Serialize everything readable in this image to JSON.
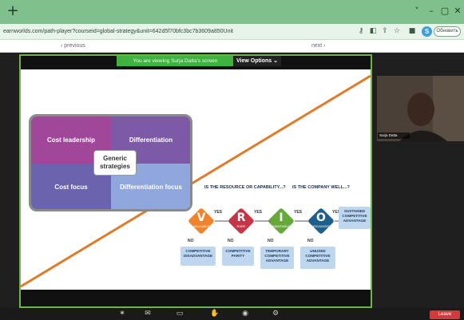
{
  "browser": {
    "new_tab": "+",
    "window_controls": [
      "˅",
      "–",
      "▢",
      "✕"
    ],
    "url": "earnworlds.com/path-player?courseid=global-strategy&unit=642d5f70bfc3bc7b3609a850Unit",
    "profile_letter": "S",
    "profile_button": "Обновить"
  },
  "page_nav": {
    "previous": "‹ previous",
    "next": "next ›"
  },
  "share": {
    "viewing_text": "You are viewing Surja Datta's screen",
    "view_options": "View Options ⌄"
  },
  "generic": {
    "center": "Generic strategies",
    "cells": [
      "Cost leadership",
      "Differentiation",
      "Cost focus",
      "Differentiation focus"
    ]
  },
  "vrio": {
    "question_left": "IS THE RESOURCE OR CAPABILITY...?",
    "question_right": "IS THE COMPANY WELL...?",
    "yes_label": "YES",
    "no_label": "NO",
    "diamonds": [
      {
        "letter": "V",
        "sub": "VALUABLE",
        "color": "#f0842c"
      },
      {
        "letter": "R",
        "sub": "RARE",
        "color": "#c63546"
      },
      {
        "letter": "I",
        "sub": "INIMITABLE",
        "color": "#67a83a"
      },
      {
        "letter": "O",
        "sub": "ORGANIZED",
        "color": "#1f5f8b"
      }
    ],
    "outcomes": [
      "COMPETITIVE DISADVANTAGE",
      "COMPETITIVE PARITY",
      "TEMPORARY COMPETITIVE ADVANTAGE",
      "UNUSED COMPETITIVE ADVANTAGE"
    ],
    "final": "SUSTAINED COMPETITIVE ADVANTAGE"
  },
  "participant": {
    "name": "Surja Datta"
  },
  "controls": {
    "leave": "Leave"
  }
}
